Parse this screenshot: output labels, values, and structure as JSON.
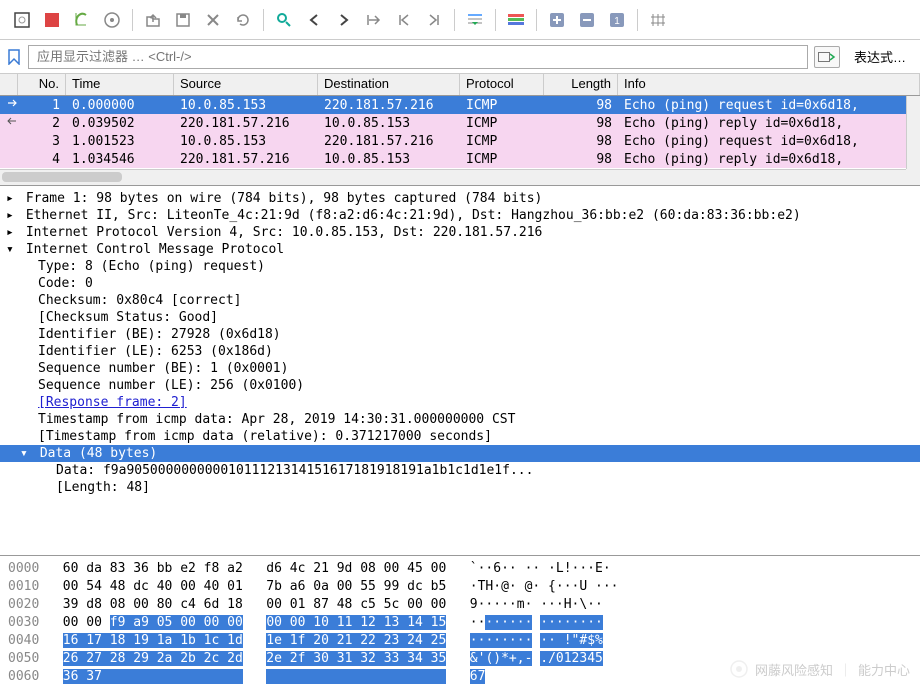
{
  "filter": {
    "placeholder": "应用显示过滤器 … <Ctrl-/>",
    "value": "",
    "expression_label": "表达式…"
  },
  "packet_list": {
    "headers": {
      "no": "No.",
      "time": "Time",
      "source": "Source",
      "destination": "Destination",
      "protocol": "Protocol",
      "length": "Length",
      "info": "Info"
    },
    "rows": [
      {
        "no": "1",
        "time": "0.000000",
        "src": "10.0.85.153",
        "dst": "220.181.57.216",
        "proto": "ICMP",
        "len": "98",
        "info": "Echo (ping) request  id=0x6d18,",
        "selected": true,
        "marker": "out"
      },
      {
        "no": "2",
        "time": "0.039502",
        "src": "220.181.57.216",
        "dst": "10.0.85.153",
        "proto": "ICMP",
        "len": "98",
        "info": "Echo (ping) reply    id=0x6d18,",
        "selected": false,
        "marker": "in"
      },
      {
        "no": "3",
        "time": "1.001523",
        "src": "10.0.85.153",
        "dst": "220.181.57.216",
        "proto": "ICMP",
        "len": "98",
        "info": "Echo (ping) request  id=0x6d18,",
        "selected": false,
        "marker": ""
      },
      {
        "no": "4",
        "time": "1.034546",
        "src": "220.181.57.216",
        "dst": "10.0.85.153",
        "proto": "ICMP",
        "len": "98",
        "info": "Echo (ping) reply    id=0x6d18,",
        "selected": false,
        "marker": ""
      }
    ]
  },
  "details": {
    "frame": "Frame 1: 98 bytes on wire (784 bits), 98 bytes captured (784 bits)",
    "eth": "Ethernet II, Src: LiteonTe_4c:21:9d (f8:a2:d6:4c:21:9d), Dst: Hangzhou_36:bb:e2 (60:da:83:36:bb:e2)",
    "ip": "Internet Protocol Version 4, Src: 10.0.85.153, Dst: 220.181.57.216",
    "icmp_hdr": "Internet Control Message Protocol",
    "icmp": {
      "type": "Type: 8 (Echo (ping) request)",
      "code": "Code: 0",
      "checksum": "Checksum: 0x80c4 [correct]",
      "checksum_status": "[Checksum Status: Good]",
      "ident_be": "Identifier (BE): 27928 (0x6d18)",
      "ident_le": "Identifier (LE): 6253 (0x186d)",
      "seq_be": "Sequence number (BE): 1 (0x0001)",
      "seq_le": "Sequence number (LE): 256 (0x0100)",
      "response": "[Response frame: 2]",
      "ts": "Timestamp from icmp data: Apr 28, 2019 14:30:31.000000000 CST",
      "ts_rel": "[Timestamp from icmp data (relative): 0.371217000 seconds]"
    },
    "data_hdr": "Data (48 bytes)",
    "data_val": "Data: f9a90500000000001011121314151617181918191a1b1c1d1e1f...",
    "data_len": "[Length: 48]"
  },
  "hex": {
    "rows": [
      {
        "off": "0000",
        "b1": "60 da 83 36 bb e2 f8 a2",
        "b2": "d6 4c 21 9d 08 00 45 00",
        "a1": "`··6·· ··",
        "a2": "·L!···E·",
        "hl": false
      },
      {
        "off": "0010",
        "b1": "00 54 48 dc 40 00 40 01",
        "b2": "7b a6 0a 00 55 99 dc b5",
        "a1": "·TH·@· @·",
        "a2": "{···U ···",
        "hl": false
      },
      {
        "off": "0020",
        "b1": "39 d8 08 00 80 c4 6d 18",
        "b2": "00 01 87 48 c5 5c 00 00",
        "a1": "9·····m·",
        "a2": "···H·\\··",
        "hl": false
      },
      {
        "off": "0030",
        "b1a": "00 00 ",
        "b1b": "f9 a9 05 00 00 00",
        "b2": "00 00 10 11 12 13 14 15",
        "a1a": "··",
        "a1b": "······",
        "a2": "········",
        "hl": "partial"
      },
      {
        "off": "0040",
        "b1": "16 17 18 19 1a 1b 1c 1d",
        "b2": "1e 1f 20 21 22 23 24 25",
        "a1": "········",
        "a2": "·· !\"#$%",
        "hl": true
      },
      {
        "off": "0050",
        "b1": "26 27 28 29 2a 2b 2c 2d",
        "b2": "2e 2f 30 31 32 33 34 35",
        "a1": "&'()*+,-",
        "a2": "./012345",
        "hl": true
      },
      {
        "off": "0060",
        "b1": "36 37",
        "b2": "",
        "a1": "67",
        "a2": "",
        "hl": true
      }
    ]
  },
  "watermark": {
    "text1": "网藤风险感知",
    "text2": "能力中心"
  }
}
